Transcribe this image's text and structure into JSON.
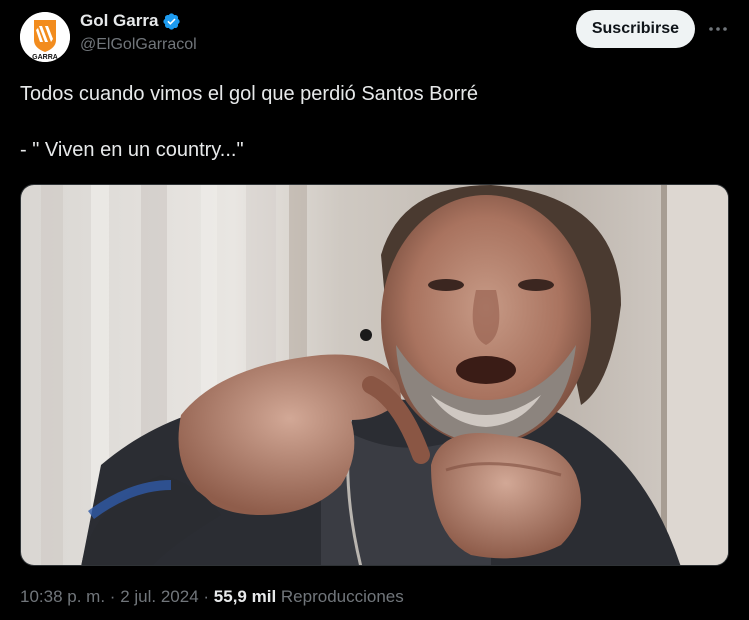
{
  "author": {
    "display_name": "Gol Garra",
    "handle": "@ElGolGarracol",
    "avatar_text": "GARRA",
    "verified": true
  },
  "actions": {
    "subscribe_label": "Suscribirse",
    "more_icon": "more-horizontal-icon"
  },
  "tweet": {
    "text_line1": "Todos cuando vimos el gol que perdió Santos Borré",
    "text_line2": "- \" Viven en un country...\""
  },
  "meta": {
    "time": "10:38 p. m.",
    "separator": "·",
    "date": "2 jul. 2024",
    "views_count": "55,9 mil",
    "views_label": "Reproducciones"
  },
  "colors": {
    "background": "#000000",
    "text_primary": "#e7e9ea",
    "text_secondary": "#71767b",
    "verified_blue": "#1d9bf0",
    "brand_orange": "#f28c1e"
  }
}
